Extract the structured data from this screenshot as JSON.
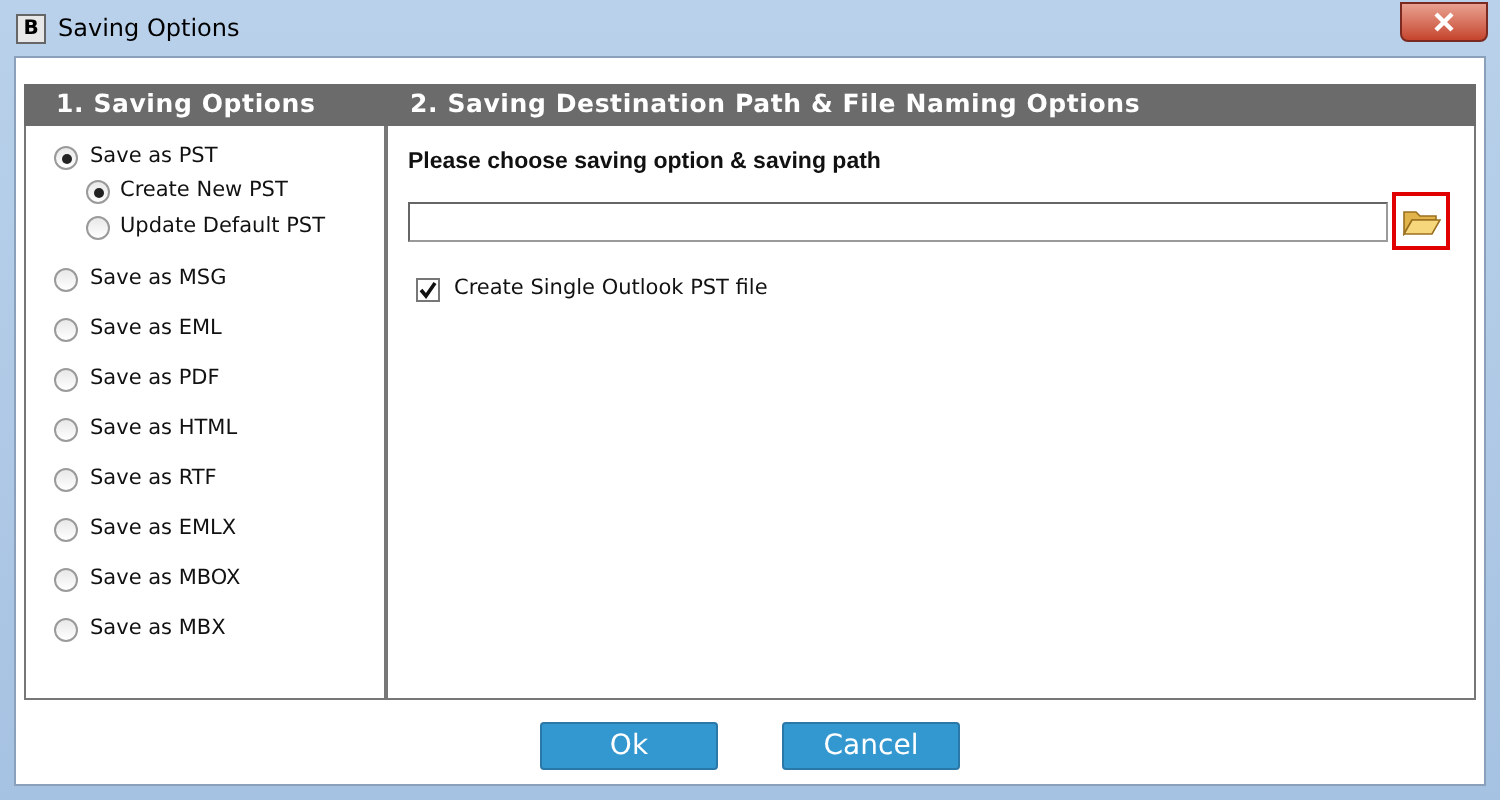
{
  "window": {
    "title": "Saving Options",
    "logo": "B"
  },
  "left_panel": {
    "heading": "1. Saving Options",
    "options": [
      {
        "label": "Save as PST",
        "selected": true,
        "children": [
          {
            "label": "Create New PST",
            "selected": true
          },
          {
            "label": "Update Default PST",
            "selected": false
          }
        ]
      },
      {
        "label": "Save as MSG",
        "selected": false
      },
      {
        "label": "Save as EML",
        "selected": false
      },
      {
        "label": "Save as PDF",
        "selected": false
      },
      {
        "label": "Save as HTML",
        "selected": false
      },
      {
        "label": "Save as RTF",
        "selected": false
      },
      {
        "label": "Save as EMLX",
        "selected": false
      },
      {
        "label": "Save as MBOX",
        "selected": false
      },
      {
        "label": "Save as MBX",
        "selected": false
      }
    ]
  },
  "right_panel": {
    "heading": "2. Saving Destination Path & File Naming Options",
    "prompt": "Please choose saving option & saving path",
    "single_pst": {
      "label": "Create Single Outlook PST file",
      "checked": true
    }
  },
  "buttons": [
    "Ok",
    "Cancel"
  ]
}
